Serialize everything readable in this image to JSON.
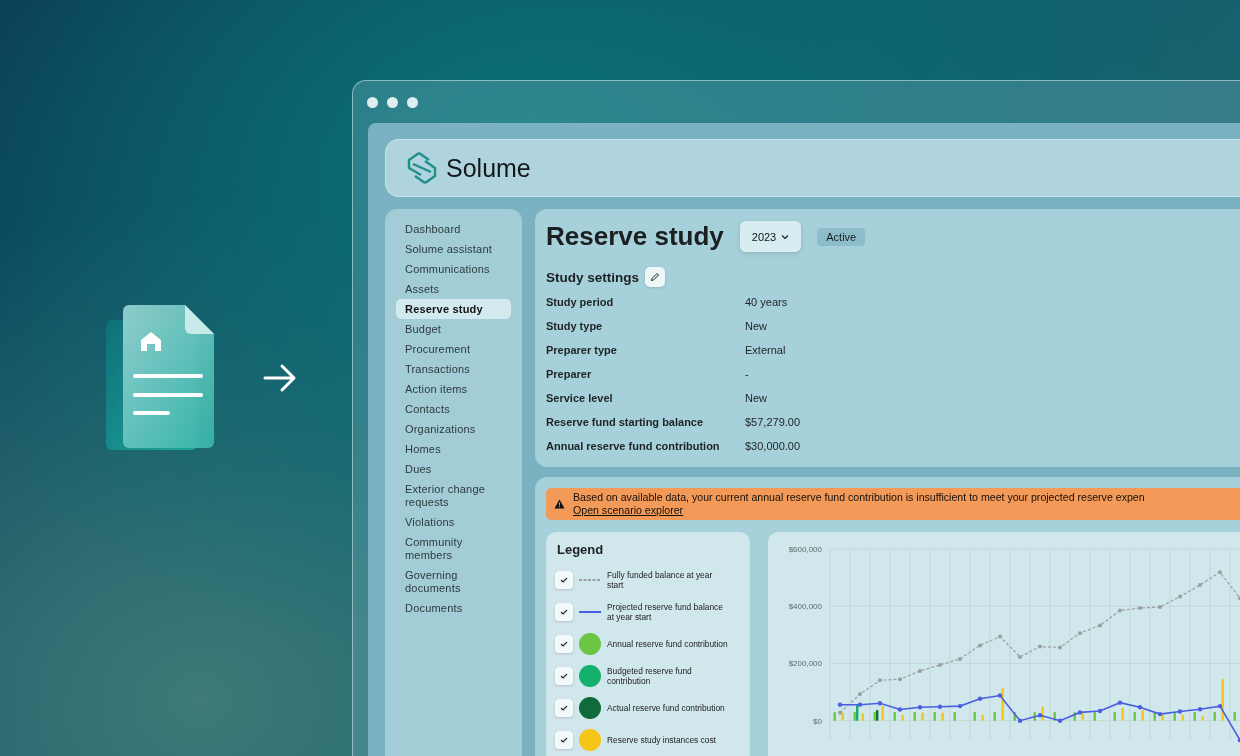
{
  "header": {
    "app_name": "Solume"
  },
  "sidebar": {
    "items": [
      {
        "label": "Dashboard",
        "selected": false
      },
      {
        "label": "Solume assistant",
        "selected": false
      },
      {
        "label": "Communications",
        "selected": false
      },
      {
        "label": "Assets",
        "selected": false
      },
      {
        "label": "Reserve study",
        "selected": true
      },
      {
        "label": "Budget",
        "selected": false
      },
      {
        "label": "Procurement",
        "selected": false
      },
      {
        "label": "Transactions",
        "selected": false
      },
      {
        "label": "Action items",
        "selected": false
      },
      {
        "label": "Contacts",
        "selected": false
      },
      {
        "label": "Organizations",
        "selected": false
      },
      {
        "label": "Homes",
        "selected": false
      },
      {
        "label": "Dues",
        "selected": false
      },
      {
        "label": "Exterior change requests",
        "selected": false
      },
      {
        "label": "Violations",
        "selected": false
      },
      {
        "label": "Community members",
        "selected": false
      },
      {
        "label": "Governing documents",
        "selected": false
      },
      {
        "label": "Documents",
        "selected": false
      }
    ]
  },
  "page": {
    "title": "Reserve study",
    "year_dropdown": "2023",
    "status_badge": "Active"
  },
  "study_settings": {
    "title": "Study settings",
    "rows": [
      {
        "label": "Study period",
        "value": "40 years"
      },
      {
        "label": "Study type",
        "value": "New"
      },
      {
        "label": "Preparer type",
        "value": "External"
      },
      {
        "label": "Preparer",
        "value": "-"
      },
      {
        "label": "Service level",
        "value": "New"
      },
      {
        "label": "Reserve fund starting balance",
        "value": "$57,279.00"
      },
      {
        "label": "Annual reserve fund contribution",
        "value": "$30,000.00"
      }
    ]
  },
  "alert": {
    "message": "Based on available data, your current annual reserve fund contribution is insufficient to meet your projected reserve expen",
    "link": "Open scenario explorer"
  },
  "legend": {
    "title": "Legend",
    "items": [
      {
        "kind": "dashed",
        "checked": true
      },
      {
        "kind": "line",
        "checked": true
      },
      {
        "kind": "dot",
        "checked": true
      },
      {
        "kind": "dot",
        "checked": true
      },
      {
        "kind": "dot",
        "checked": true
      },
      {
        "kind": "dot",
        "checked": true
      }
    ]
  },
  "chart": {
    "chart_data": {
      "type": "line",
      "grid": true,
      "yticks": [
        {
          "value": 0,
          "label": "$0"
        },
        {
          "value": 200000,
          "label": "$200,000"
        },
        {
          "value": 400000,
          "label": "$400,000"
        },
        {
          "value": 600000,
          "label": "$600,000"
        }
      ],
      "ylim": [
        -70000,
        600000
      ],
      "series": [
        {
          "name": "Fully funded balance at year start",
          "type": "line",
          "line_style": "dashed",
          "color": "#9a9fa2",
          "values": [
            28000,
            93000,
            141000,
            145000,
            174000,
            195000,
            216000,
            263000,
            294000,
            223000,
            259000,
            256000,
            306000,
            333000,
            385000,
            394000,
            397000,
            434000,
            474000,
            519000,
            428000
          ]
        },
        {
          "name": "Projected reserve fund balance at year start",
          "type": "line",
          "line_style": "solid",
          "color": "#4a5fe0",
          "values": [
            56000,
            56000,
            61000,
            39000,
            47000,
            49000,
            51000,
            77000,
            88000,
            0,
            19000,
            0,
            29000,
            34000,
            63000,
            47000,
            23000,
            32000,
            40000,
            51000,
            -68000
          ]
        },
        {
          "name": "Annual reserve fund contribution",
          "type": "bar",
          "color": "#6cc644",
          "values": [
            30000,
            30000,
            30000,
            30000,
            30000,
            30000,
            30000,
            30000,
            30000,
            30000,
            30000,
            30000,
            30000,
            30000,
            30000,
            30000,
            30000,
            30000,
            30000,
            30000,
            30000
          ]
        },
        {
          "name": "Budgeted reserve fund contribution",
          "type": "bar",
          "color": "#12b06a",
          "values": [
            null,
            55000,
            null,
            null,
            null,
            null,
            null,
            null,
            null,
            null,
            null,
            null,
            null,
            null,
            null,
            null,
            null,
            null,
            null,
            null,
            null
          ]
        },
        {
          "name": "Actual reserve fund contribution",
          "type": "bar",
          "color": "#0f6b3a",
          "values": [
            null,
            null,
            37000,
            null,
            null,
            null,
            null,
            null,
            null,
            null,
            null,
            null,
            null,
            null,
            null,
            null,
            null,
            null,
            null,
            null,
            null
          ]
        },
        {
          "name": "Reserve study instances cost",
          "type": "bar",
          "color": "#f5c518",
          "values": [
            28000,
            26000,
            51000,
            20000,
            28000,
            28000,
            2000,
            20000,
            114000,
            null,
            49000,
            null,
            26000,
            2000,
            44000,
            37000,
            20000,
            20000,
            16000,
            146000,
            null
          ]
        }
      ]
    }
  }
}
